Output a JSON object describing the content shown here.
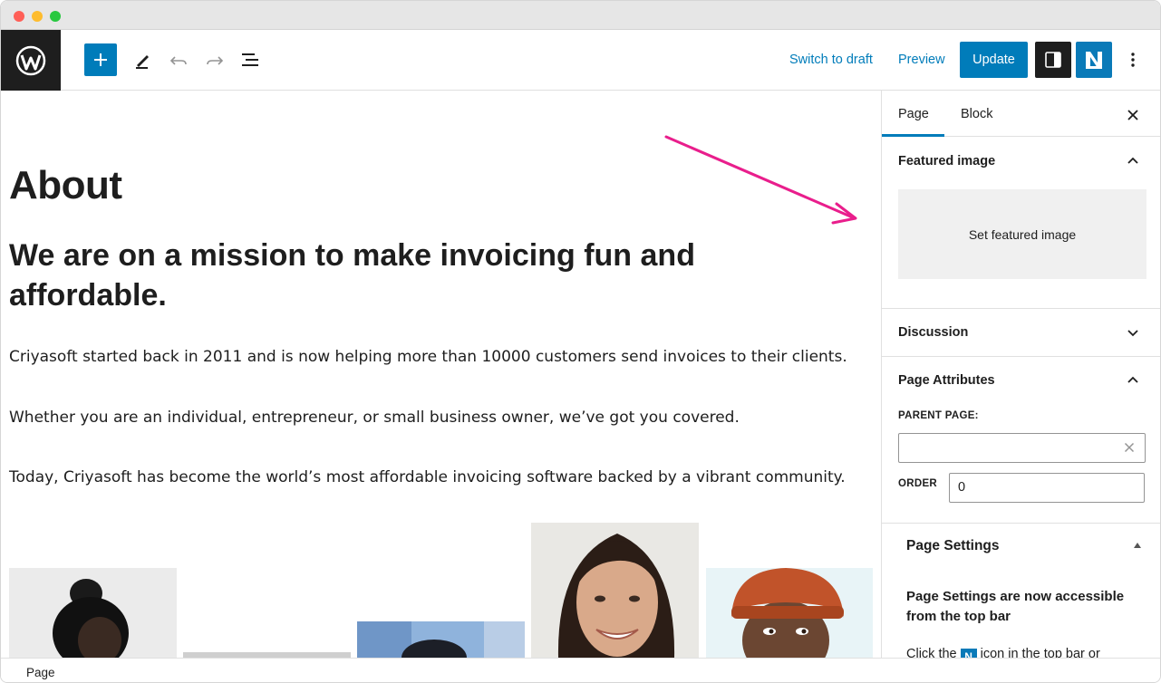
{
  "toolbar": {
    "switch_to_draft": "Switch to draft",
    "preview": "Preview",
    "update": "Update",
    "accent_color": "#007cba"
  },
  "editor": {
    "title": "About",
    "headline": "We are on a mission to make invoicing fun and affordable.",
    "paragraphs": [
      "Criyasoft started back in 2011 and is now helping more than 10000 customers send invoices to their clients.",
      "Whether you are an individual, entrepreneur, or small business owner, we’ve got you covered.",
      "Today, Criyasoft has become the world’s most affordable invoicing software backed by a vibrant community."
    ],
    "annotation_arrow_color": "#e91e8c"
  },
  "sidebar": {
    "tabs": [
      "Page",
      "Block"
    ],
    "featured_image": {
      "heading": "Featured image",
      "set_label": "Set featured image"
    },
    "discussion": {
      "heading": "Discussion"
    },
    "page_attributes": {
      "heading": "Page Attributes",
      "parent_label": "PARENT PAGE:",
      "parent_value": "",
      "order_label": "ORDER",
      "order_value": "0"
    },
    "page_settings": {
      "heading": "Page Settings",
      "notice_title": "Page Settings are now accessible from the top bar",
      "notice_text_start": "Click the",
      "notice_text_end": "icon in the top bar or"
    }
  },
  "statusbar": {
    "breadcrumb": "Page"
  }
}
